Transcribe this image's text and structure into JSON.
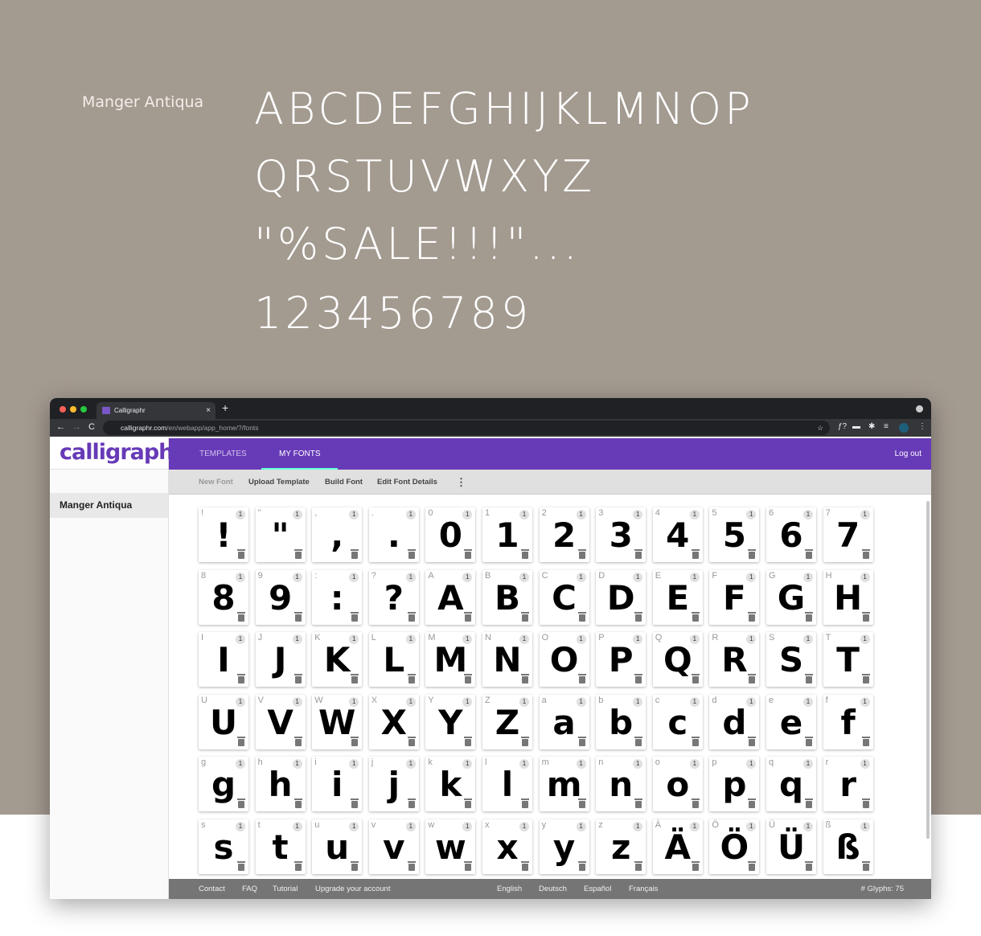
{
  "showcase": {
    "font_name": "Manger Antiqua",
    "lines": [
      "ABCDEFGHIJKLMNOP",
      "QRSTUVWXYZ",
      "\"%SALE!!!\"...",
      "123456789"
    ]
  },
  "browser": {
    "tab_title": "Calligraphr",
    "url_host": "calligraphr.com",
    "url_path": "/en/webapp/app_home/?/fonts",
    "close": "×",
    "new_tab": "+",
    "back": "←",
    "forward": "→",
    "reload": "C"
  },
  "app": {
    "logo": "calligraphr",
    "accent": "#673ab7",
    "nav": {
      "templates": "TEMPLATES",
      "my_fonts": "MY FONTS",
      "logout": "Log out"
    },
    "toolbar": {
      "new_font": "New Font",
      "upload_template": "Upload Template",
      "build_font": "Build Font",
      "edit_font_details": "Edit Font Details",
      "more": "⋮"
    },
    "sidebar": {
      "fonts": [
        "Manger Antiqua"
      ]
    },
    "glyphs": [
      "!",
      "\"",
      ",",
      ".",
      "0",
      "1",
      "2",
      "3",
      "4",
      "5",
      "6",
      "7",
      "8",
      "9",
      ":",
      "?",
      "A",
      "B",
      "C",
      "D",
      "E",
      "F",
      "G",
      "H",
      "I",
      "J",
      "K",
      "L",
      "M",
      "N",
      "O",
      "P",
      "Q",
      "R",
      "S",
      "T",
      "U",
      "V",
      "W",
      "X",
      "Y",
      "Z",
      "a",
      "b",
      "c",
      "d",
      "e",
      "f",
      "g",
      "h",
      "i",
      "j",
      "k",
      "l",
      "m",
      "n",
      "o",
      "p",
      "q",
      "r",
      "s",
      "t",
      "u",
      "v",
      "w",
      "x",
      "y",
      "z",
      "Ä",
      "Ö",
      "Ü",
      "ß"
    ],
    "glyph_count_badge": "1",
    "footer": {
      "links": [
        "Contact",
        "FAQ",
        "Tutorial",
        "Upgrade your account"
      ],
      "languages": [
        "English",
        "Deutsch",
        "Español",
        "Français"
      ],
      "glyph_total": "# Glyphs: 75"
    }
  }
}
